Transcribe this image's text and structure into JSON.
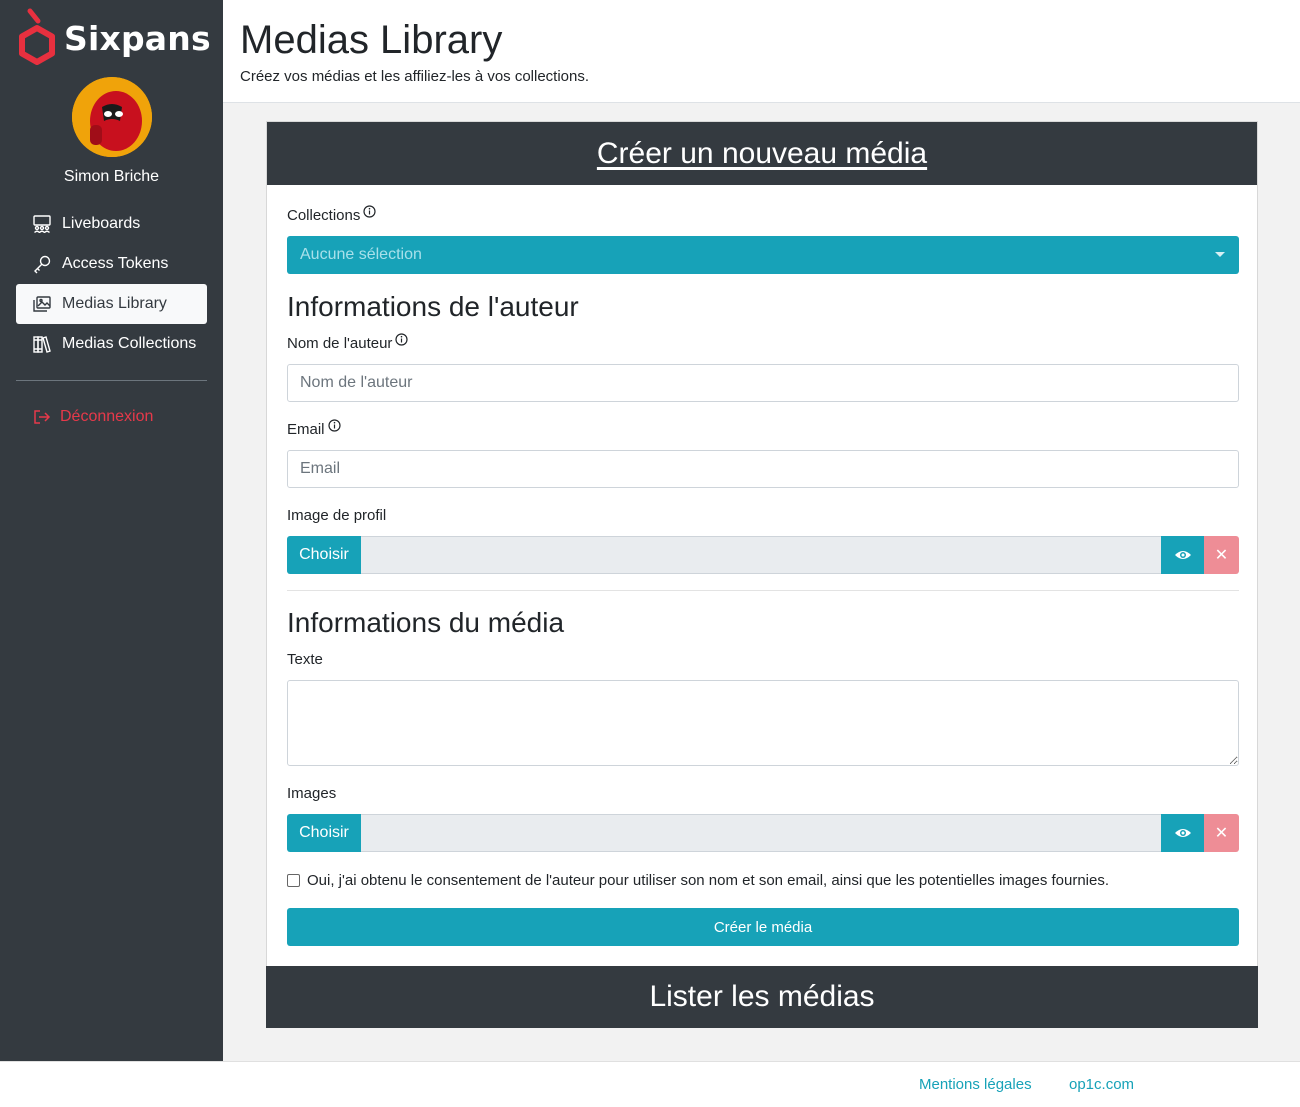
{
  "brand": {
    "name": "Sixpans"
  },
  "user": {
    "name": "Simon Briche"
  },
  "sidebar": {
    "items": [
      {
        "label": "Liveboards",
        "icon": "liveboards-icon"
      },
      {
        "label": "Access Tokens",
        "icon": "key-icon"
      },
      {
        "label": "Medias Library",
        "icon": "images-icon",
        "active": true
      },
      {
        "label": "Medias Collections",
        "icon": "books-icon"
      }
    ],
    "logout": {
      "label": "Déconnexion",
      "icon": "logout-icon"
    }
  },
  "header": {
    "title": "Medias Library",
    "subtitle": "Créez vos médias et les affiliez-les à vos collections."
  },
  "card": {
    "title": "Créer un nouveau média",
    "collections_label": "Collections",
    "collections_select": "Aucune sélection",
    "author_section": "Informations de l'auteur",
    "author_name_label": "Nom de l'auteur",
    "author_name_placeholder": "Nom de l'auteur",
    "email_label": "Email",
    "email_placeholder": "Email",
    "profile_image_label": "Image de profil",
    "choose_label": "Choisir",
    "media_section": "Informations du média",
    "text_label": "Texte",
    "images_label": "Images",
    "consent_text": "Oui, j'ai obtenu le consentement de l'auteur pour utiliser son nom et son email, ainsi que les potentielles images fournies.",
    "submit_label": "Créer le média",
    "list_title": "Lister les médias"
  },
  "footer": {
    "legal": "Mentions légales",
    "site": "op1c.com"
  },
  "colors": {
    "sidebar_bg": "#343a40",
    "accent": "#17a2b8",
    "danger": "#e6394a",
    "danger_light": "#ee8d96",
    "brand_red": "#e8303f"
  }
}
